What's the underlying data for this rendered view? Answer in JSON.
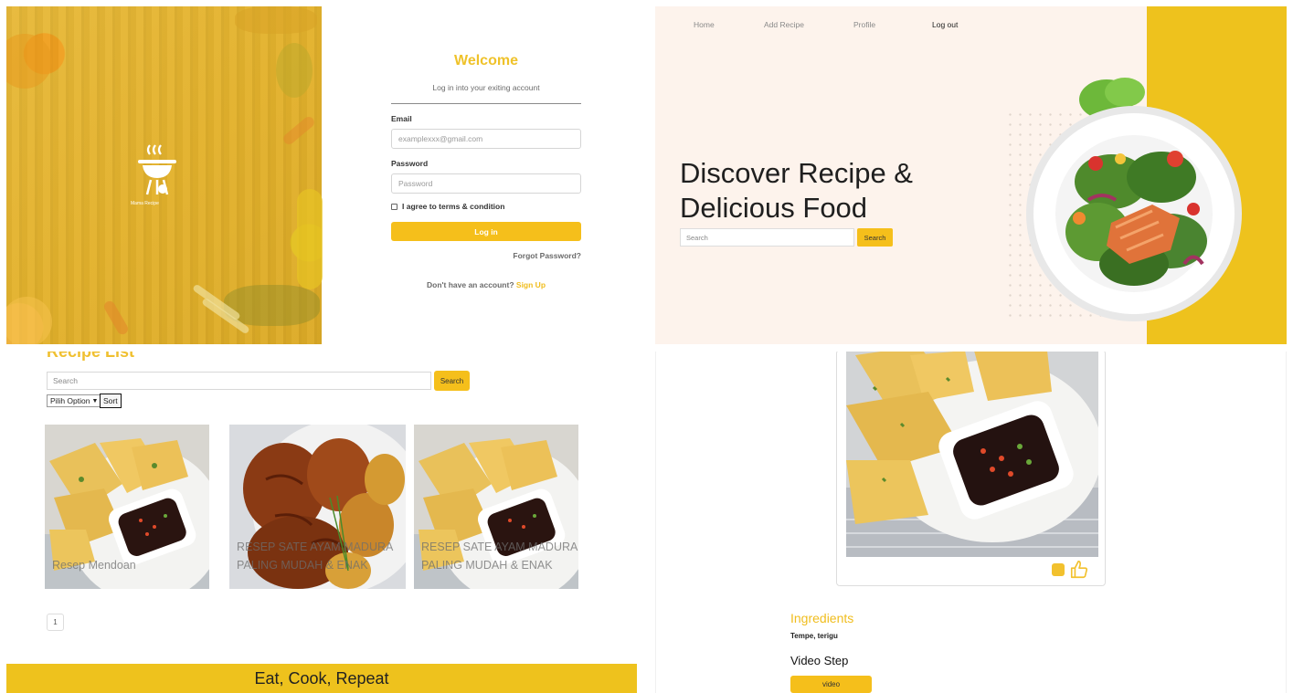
{
  "login": {
    "brand": "Mama Recipe",
    "welcome": "Welcome",
    "subtitle": "Log in into your exiting account",
    "email_label": "Email",
    "email_placeholder": "examplexxx@gmail.com",
    "password_label": "Password",
    "password_placeholder": "Password",
    "agree_label": "I agree to terms & condition",
    "login_button": "Log in",
    "forgot_link": "Forgot Password?",
    "no_account_text": "Don't have an account?",
    "signup_link": "Sign Up"
  },
  "home": {
    "nav": [
      "Home",
      "Add Recipe",
      "Profile",
      "Log out"
    ],
    "hero_line1": "Discover Recipe &",
    "hero_line2": "Delicious Food",
    "search_placeholder": "Search",
    "search_button": "Search"
  },
  "list": {
    "title": "Recipe List",
    "search_placeholder": "Search",
    "search_button": "Search",
    "select_value": "Pilih Option",
    "sort_button": "Sort",
    "cards": [
      {
        "title": "Resep Mendoan"
      },
      {
        "title": "RESEP SATE AYAM MADURA PALING MUDAH & ENAK"
      },
      {
        "title": "RESEP SATE AYAM MADURA PALING MUDAH & ENAK"
      }
    ],
    "page": "1",
    "footer": "Eat, Cook, Repeat"
  },
  "detail": {
    "ingredients_title": "Ingredients",
    "ingredients": "Tempe, terigu",
    "video_title": "Video Step",
    "video_button": "video"
  },
  "colors": {
    "accent": "#f5bf1b",
    "brand_yellow": "#eec21d",
    "hero_bg": "#fdf3ec"
  }
}
